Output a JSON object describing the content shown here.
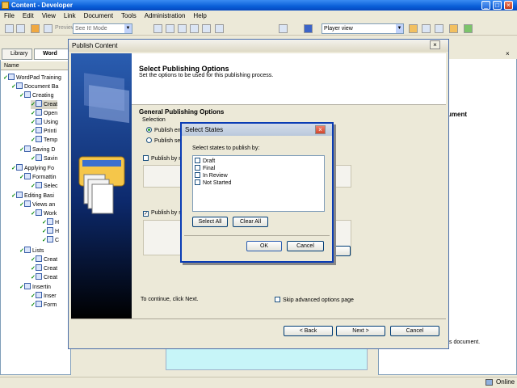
{
  "window": {
    "title": "Content - Developer"
  },
  "menu": [
    "File",
    "Edit",
    "View",
    "Link",
    "Document",
    "Tools",
    "Administration",
    "Help"
  ],
  "toolbar": {
    "preview_label": "Preview",
    "mode_value": "See It! Mode",
    "player_value": "Player view"
  },
  "left_panel": {
    "tabs": [
      "Library",
      "Word"
    ],
    "column_header": "Name",
    "tree": [
      {
        "label": "WordPad Training"
      },
      {
        "label": "Document Ba"
      },
      {
        "label": "Creating"
      },
      {
        "label": "Creat"
      },
      {
        "label": "Open"
      },
      {
        "label": "Using"
      },
      {
        "label": "Printi"
      },
      {
        "label": "Temp"
      },
      {
        "label": "Saving D"
      },
      {
        "label": "Savin"
      },
      {
        "label": "Applying Fo"
      },
      {
        "label": "Formattin"
      },
      {
        "label": "Selec"
      },
      {
        "label": "Editing Basi"
      },
      {
        "label": "Views an"
      },
      {
        "label": "Work"
      },
      {
        "label": "H"
      },
      {
        "label": "H"
      },
      {
        "label": "C"
      },
      {
        "label": "Lists"
      },
      {
        "label": "Creat"
      },
      {
        "label": "Creat"
      },
      {
        "label": "Creat"
      },
      {
        "label": "Insertin"
      },
      {
        "label": "Inser"
      },
      {
        "label": "Form"
      }
    ]
  },
  "right_panel": {
    "heading": "ument",
    "note": "s document."
  },
  "status": {
    "online": "Online"
  },
  "publish_dialog": {
    "title": "Publish Content",
    "header_title": "Select Publishing Options",
    "header_subtitle": "Set the options to be used for this publishing process.",
    "section": "General Publishing Options",
    "selection_label": "Selection",
    "radio_entire": "Publish en",
    "radio_selected": "Publish se",
    "check_publish_by_n": "Publish by n",
    "check_publish_by_s": "Publish by s",
    "continue_text": "To continue, click Next.",
    "skip_label": "Skip advanced options page",
    "back_button": "< Back",
    "next_button": "Next >",
    "cancel_button": "Cancel"
  },
  "select_states": {
    "title": "Select States",
    "prompt": "Select states to publish by:",
    "states": [
      "Draft",
      "Final",
      "In Review",
      "Not Started"
    ],
    "select_all": "Select All",
    "clear_all": "Clear All",
    "ok": "OK",
    "cancel": "Cancel"
  }
}
